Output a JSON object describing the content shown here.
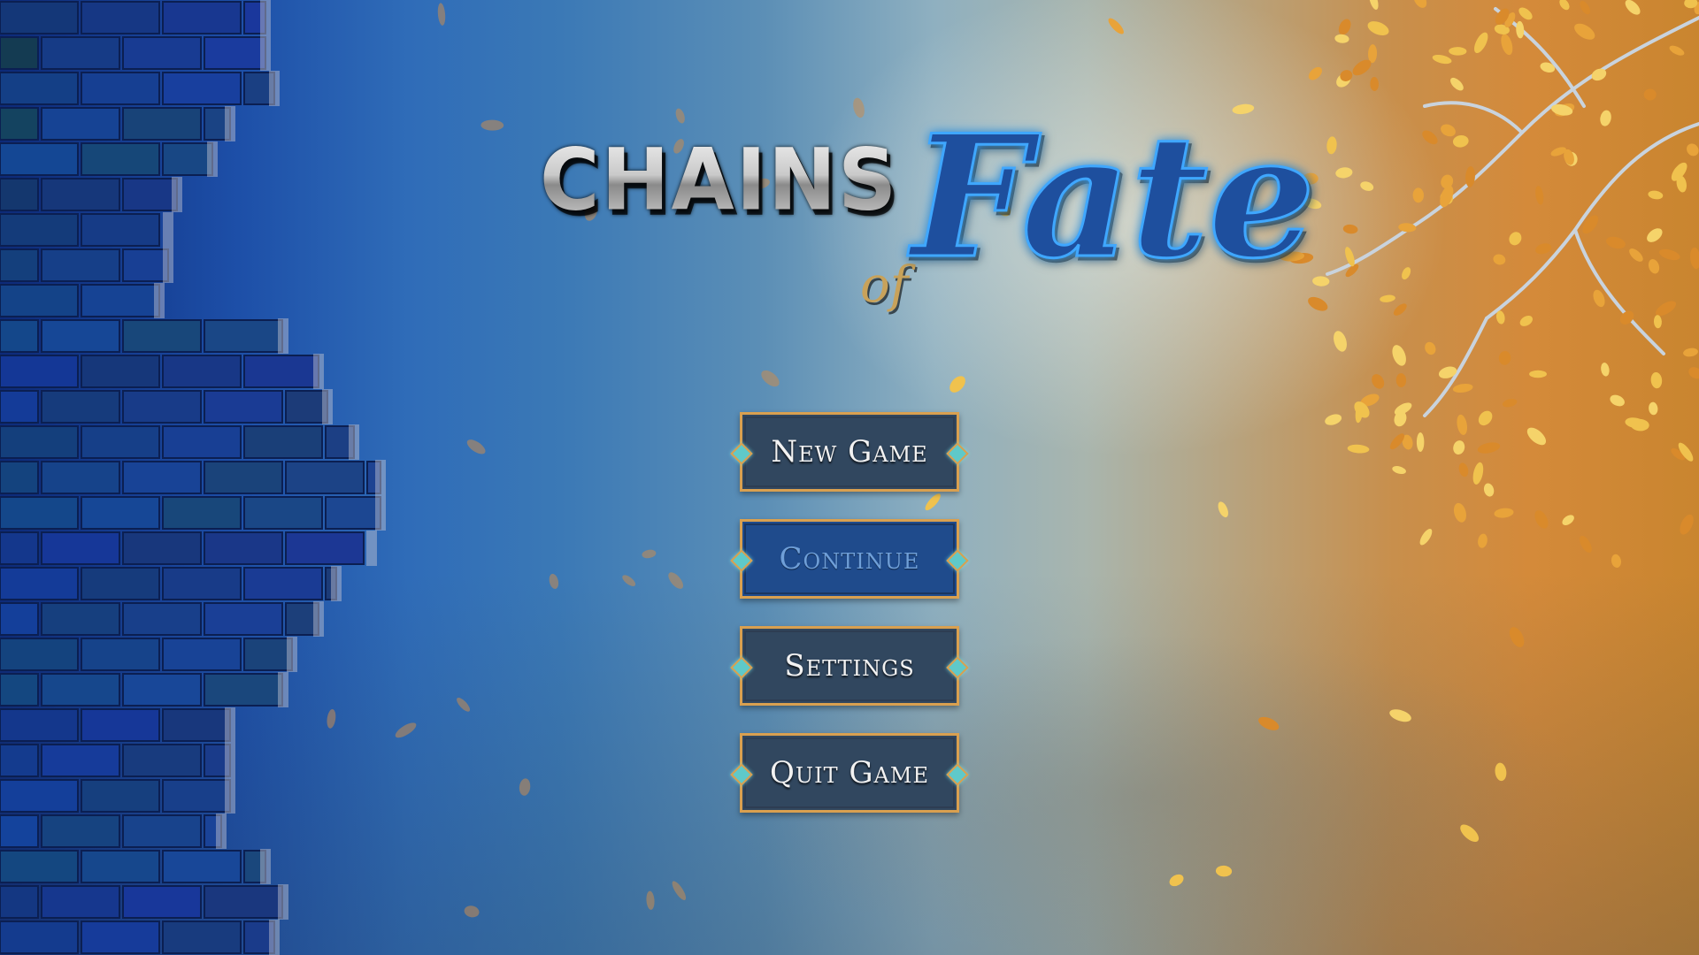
{
  "title": {
    "word_chains": "Chains",
    "word_of": "of",
    "word_fate": "Fate"
  },
  "menu": {
    "items": [
      {
        "id": "new-game",
        "label": "New Game",
        "selected": false
      },
      {
        "id": "continue",
        "label": "Continue",
        "selected": true
      },
      {
        "id": "settings",
        "label": "Settings",
        "selected": false
      },
      {
        "id": "quit-game",
        "label": "Quit Game",
        "selected": false
      }
    ]
  },
  "colors": {
    "button_fill": "#31475f",
    "button_selected_fill": "#1f4b8c",
    "button_border": "#d9a050",
    "gem": "#5fc9c9",
    "title_fate": "#3fa7ff",
    "title_of": "#c8a25a",
    "brick_wall": "#1b3f96",
    "leaves": "#f0b84a"
  }
}
